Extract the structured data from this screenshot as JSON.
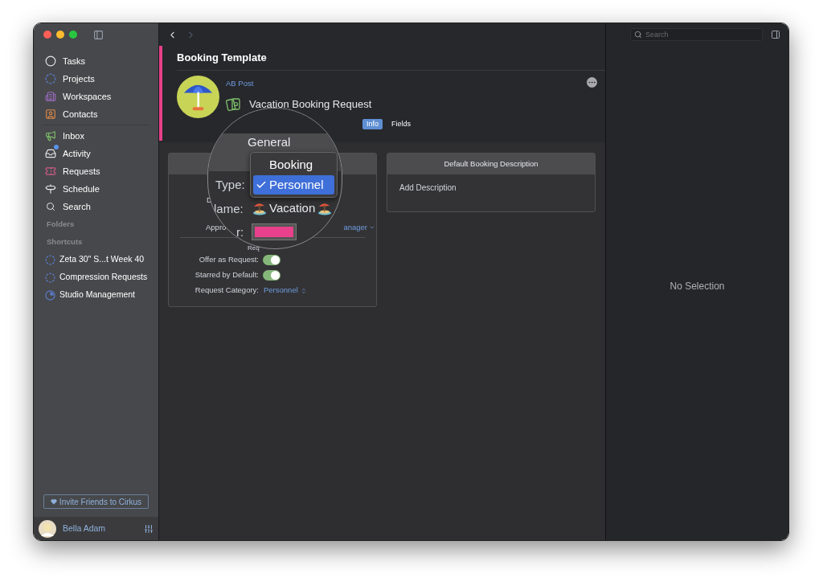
{
  "sidebar": {
    "groups": [
      {
        "items": [
          {
            "label": "Tasks"
          },
          {
            "label": "Projects"
          },
          {
            "label": "Workspaces"
          },
          {
            "label": "Contacts"
          }
        ]
      },
      {
        "items": [
          {
            "label": "Inbox"
          },
          {
            "label": "Activity"
          },
          {
            "label": "Requests"
          },
          {
            "label": "Schedule"
          },
          {
            "label": "Search"
          }
        ]
      }
    ],
    "sections": [
      {
        "title": "Folders"
      },
      {
        "title": "Shortcuts",
        "items": [
          {
            "label": "Zeta 30\" S...t Week 40"
          },
          {
            "label": "Compression Requests"
          },
          {
            "label": "Studio Management"
          }
        ]
      }
    ],
    "invite_button": "Invite Friends to Cirkus",
    "user": {
      "name": "Bella Adam"
    }
  },
  "header": {
    "title": "Booking Template",
    "owner": "AB Post",
    "name": "Vacation Booking Request",
    "tabs": [
      {
        "label": "Info",
        "selected": true
      },
      {
        "label": "Fields",
        "selected": false
      }
    ]
  },
  "general_card": {
    "row_1_label": "D",
    "row_2_label": "Appro",
    "row_2_value": "anager",
    "section_label": "Req",
    "toggles": [
      {
        "label": "Offer as Request:",
        "on": true
      },
      {
        "label": "Starred by Default:",
        "on": true
      }
    ],
    "category": {
      "label": "Request Category:",
      "value": "Personnel"
    }
  },
  "magnifier": {
    "title": "General",
    "type_label": "Type:",
    "menu": [
      {
        "label": "Booking",
        "selected": false
      },
      {
        "label": "Personnel",
        "selected": true
      }
    ],
    "name_label": "lame:",
    "name_value": "Vacation",
    "approver_label": "r:"
  },
  "description_card": {
    "title": "Default Booking Description",
    "placeholder": "Add Description"
  },
  "inspector": {
    "search_placeholder": "Search",
    "empty_text": "No Selection"
  }
}
